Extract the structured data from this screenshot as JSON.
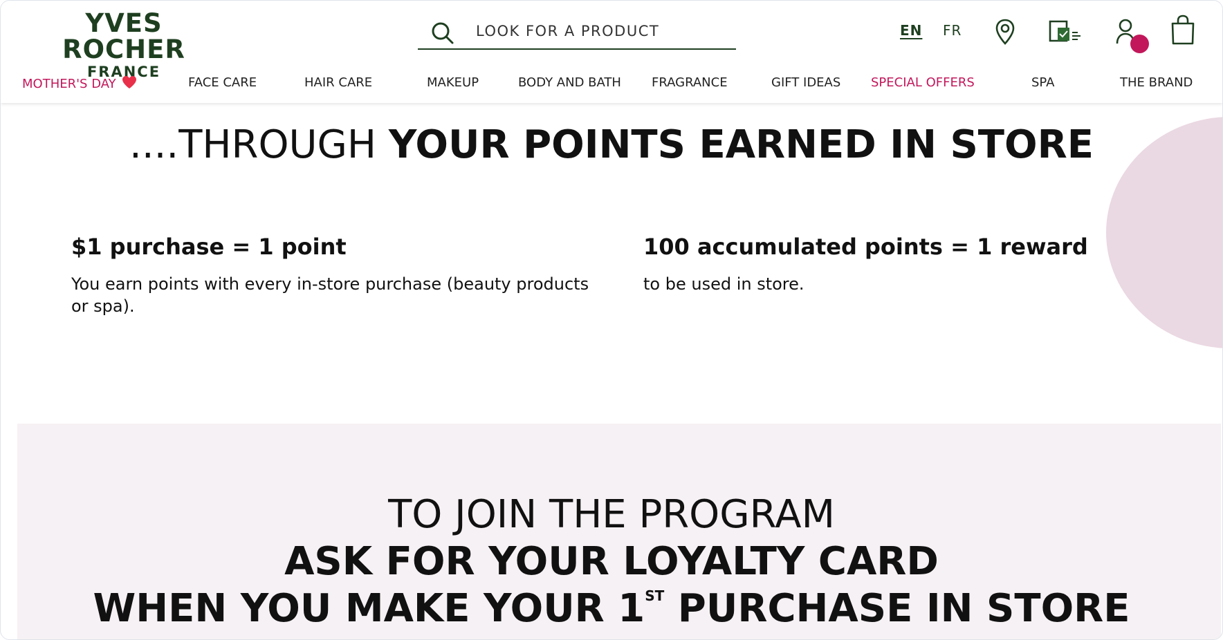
{
  "header": {
    "logo": {
      "line1": "YVES ROCHER",
      "line2": "FRANCE"
    },
    "search": {
      "placeholder": "LOOK FOR A PRODUCT"
    },
    "languages": [
      "EN",
      "FR"
    ],
    "active_language": "EN",
    "icons": [
      "search-icon",
      "location-pin-icon",
      "loyalty-card-icon",
      "account-icon",
      "shopping-bag-icon"
    ],
    "brand_color": "#1e3f20",
    "accent_color": "#c2185b"
  },
  "nav": {
    "items": [
      {
        "label": "MOTHER'S DAY",
        "highlight": true,
        "icon": "heart-icon"
      },
      {
        "label": "FACE CARE"
      },
      {
        "label": "HAIR CARE"
      },
      {
        "label": "MAKEUP"
      },
      {
        "label": "BODY AND BATH"
      },
      {
        "label": "FRAGRANCE"
      },
      {
        "label": "GIFT IDEAS"
      },
      {
        "label": "SPECIAL OFFERS",
        "highlight": true
      },
      {
        "label": "SPA"
      },
      {
        "label": "THE BRAND"
      }
    ]
  },
  "points_section": {
    "title_light": "....THROUGH ",
    "title_bold": "YOUR POINTS EARNED IN STORE",
    "columns": [
      {
        "heading": "$1 purchase = 1 point",
        "text": "You earn points with every in-store purchase (beauty products or spa)."
      },
      {
        "heading": "100 accumulated points = 1 reward",
        "text": "to be used in store."
      }
    ]
  },
  "join_section": {
    "line1": "TO JOIN THE PROGRAM",
    "line2": "ASK FOR YOUR LOYALTY CARD",
    "line3_before": "WHEN YOU MAKE YOUR 1",
    "line3_sup": "ST",
    "line3_after": " PURCHASE IN STORE"
  }
}
